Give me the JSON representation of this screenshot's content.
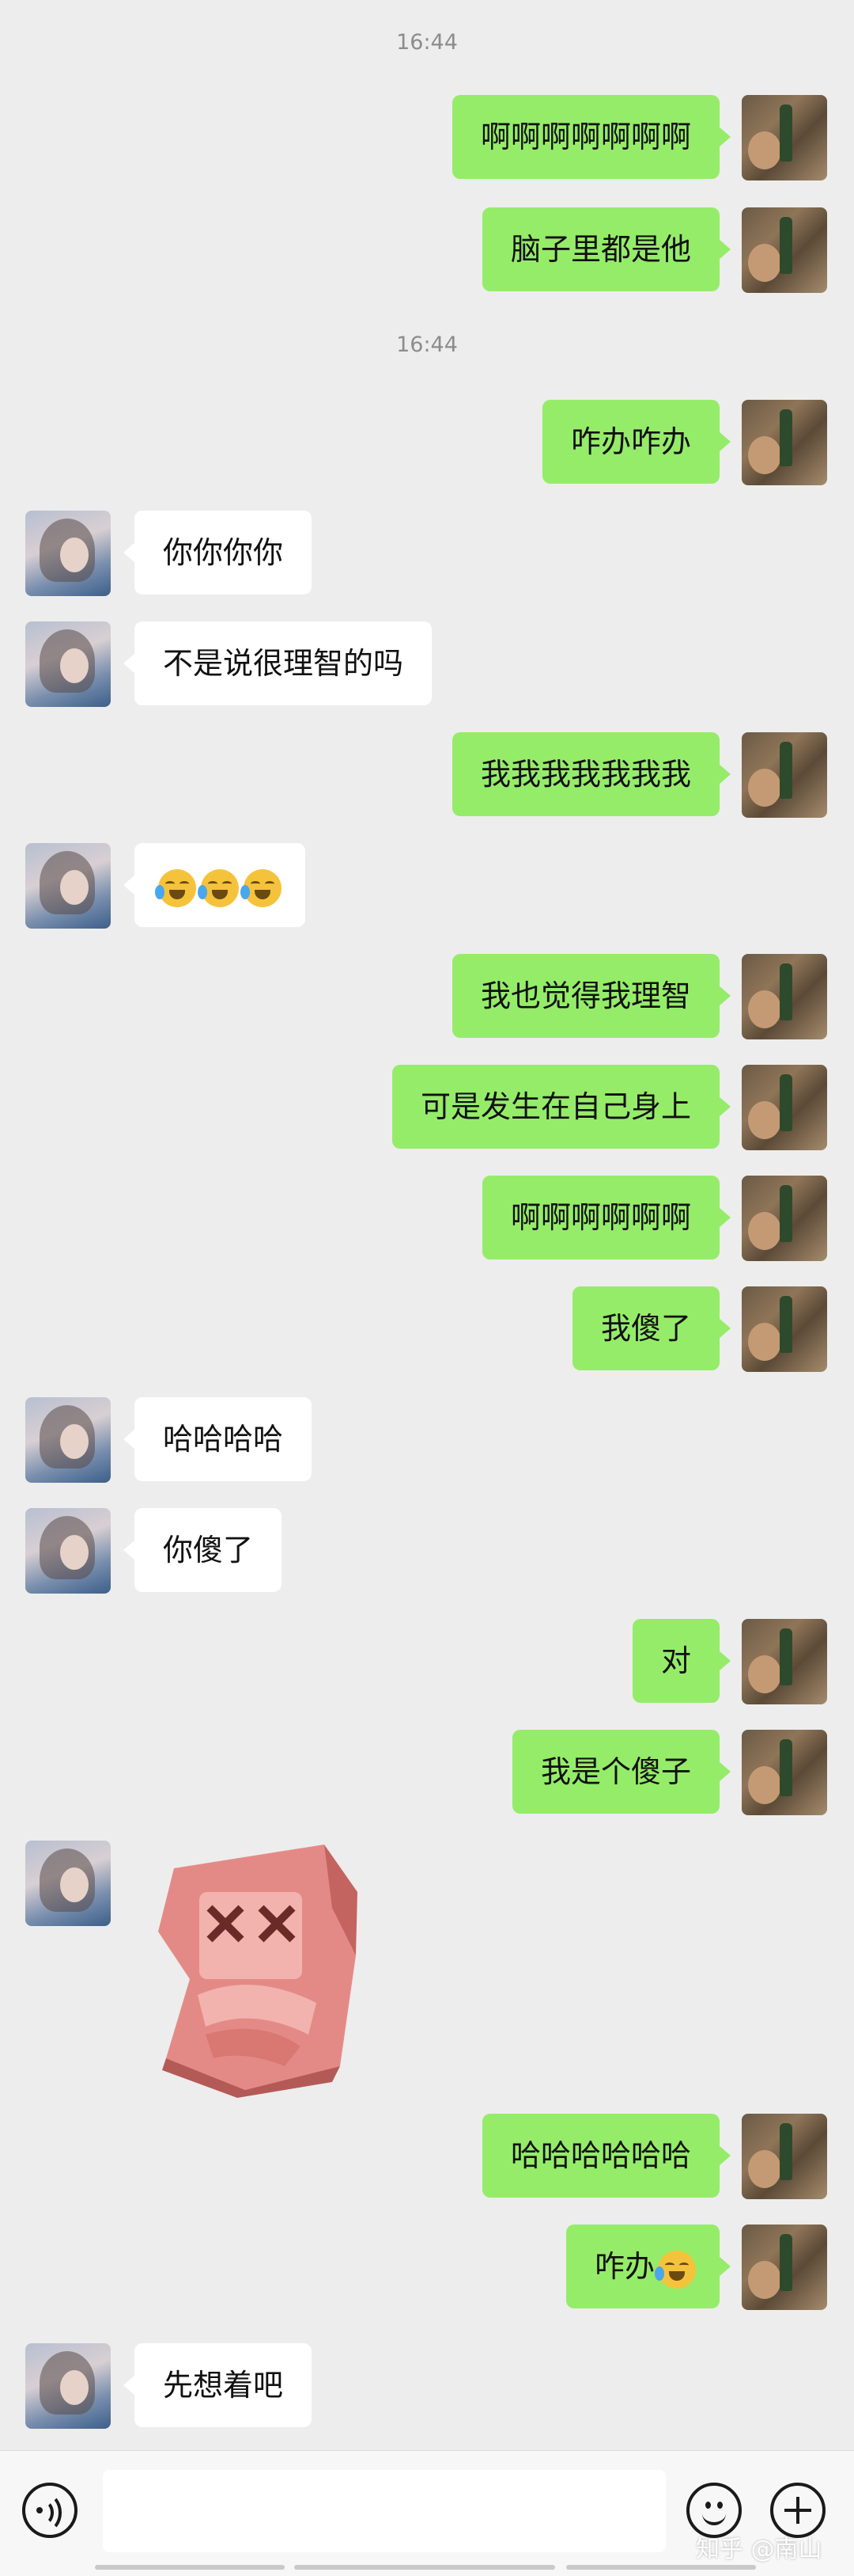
{
  "messages": [
    {
      "type": "time",
      "text": "16:44"
    },
    {
      "type": "out",
      "text": "啊啊啊啊啊啊啊"
    },
    {
      "type": "out",
      "text": "脑子里都是他"
    },
    {
      "type": "time",
      "text": "16:44"
    },
    {
      "type": "out",
      "text": "咋办咋办"
    },
    {
      "type": "in",
      "text": "你你你你"
    },
    {
      "type": "in",
      "text": "不是说很理智的吗"
    },
    {
      "type": "out",
      "text": "我我我我我我我"
    },
    {
      "type": "in",
      "emoji": "joy-tears-emoji",
      "count": 3
    },
    {
      "type": "out",
      "text": "我也觉得我理智"
    },
    {
      "type": "out",
      "text": "可是发生在自己身上"
    },
    {
      "type": "out",
      "text": "啊啊啊啊啊啊"
    },
    {
      "type": "out",
      "text": "我傻了"
    },
    {
      "type": "in",
      "text": "哈哈哈哈"
    },
    {
      "type": "in",
      "text": "你傻了"
    },
    {
      "type": "out",
      "text": "对"
    },
    {
      "type": "out",
      "text": "我是个傻子"
    },
    {
      "type": "in",
      "sticker": "shy-character-sticker"
    },
    {
      "type": "out",
      "text": "哈哈哈哈哈哈"
    },
    {
      "type": "out",
      "text": "咋办",
      "emoji": "joy-tears-emoji"
    },
    {
      "type": "in",
      "text": "先想着吧"
    }
  ],
  "input_bar": {
    "placeholder": "",
    "icons": [
      "voice-icon",
      "emoji-icon",
      "plus-icon"
    ]
  },
  "watermark": "知乎 @南山",
  "colors": {
    "background": "#ededed",
    "outgoing": "#95ec69",
    "incoming": "#ffffff",
    "timestamp": "#8c8c8c"
  }
}
